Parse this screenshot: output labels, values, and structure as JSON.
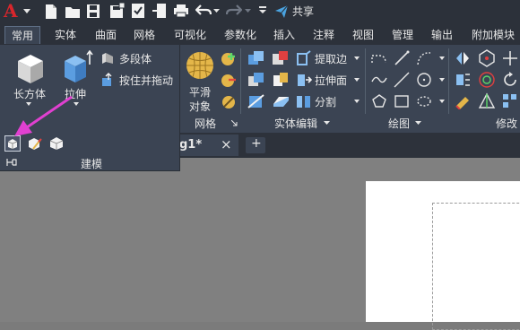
{
  "qat": {
    "app_letter": "A",
    "share_label": "共享"
  },
  "tabs": [
    "常用",
    "实体",
    "曲面",
    "网格",
    "可视化",
    "参数化",
    "插入",
    "注释",
    "视图",
    "管理",
    "输出",
    "附加模块"
  ],
  "ribbon": {
    "mesh_group": {
      "smooth_label_line1": "平滑",
      "smooth_label_line2": "对象",
      "title": "网格"
    },
    "solid_edit_group": {
      "extract_edges": "提取边",
      "extrude_faces": "拉伸面",
      "split": "分割",
      "title": "实体编辑"
    },
    "draw_group": {
      "title": "绘图"
    },
    "modify_group": {
      "title": "修改"
    }
  },
  "flyout": {
    "box_label": "长方体",
    "extrude_label": "拉伸",
    "polysolid_label": "多段体",
    "presspull_label": "按住并拖动",
    "title": "建模"
  },
  "doctab": {
    "name": "g1*",
    "close": "×",
    "new": "+"
  },
  "colors": {
    "accent_arrow": "#e040d0",
    "ribbon_bg": "#3b4453",
    "app_red": "#d8262c"
  }
}
